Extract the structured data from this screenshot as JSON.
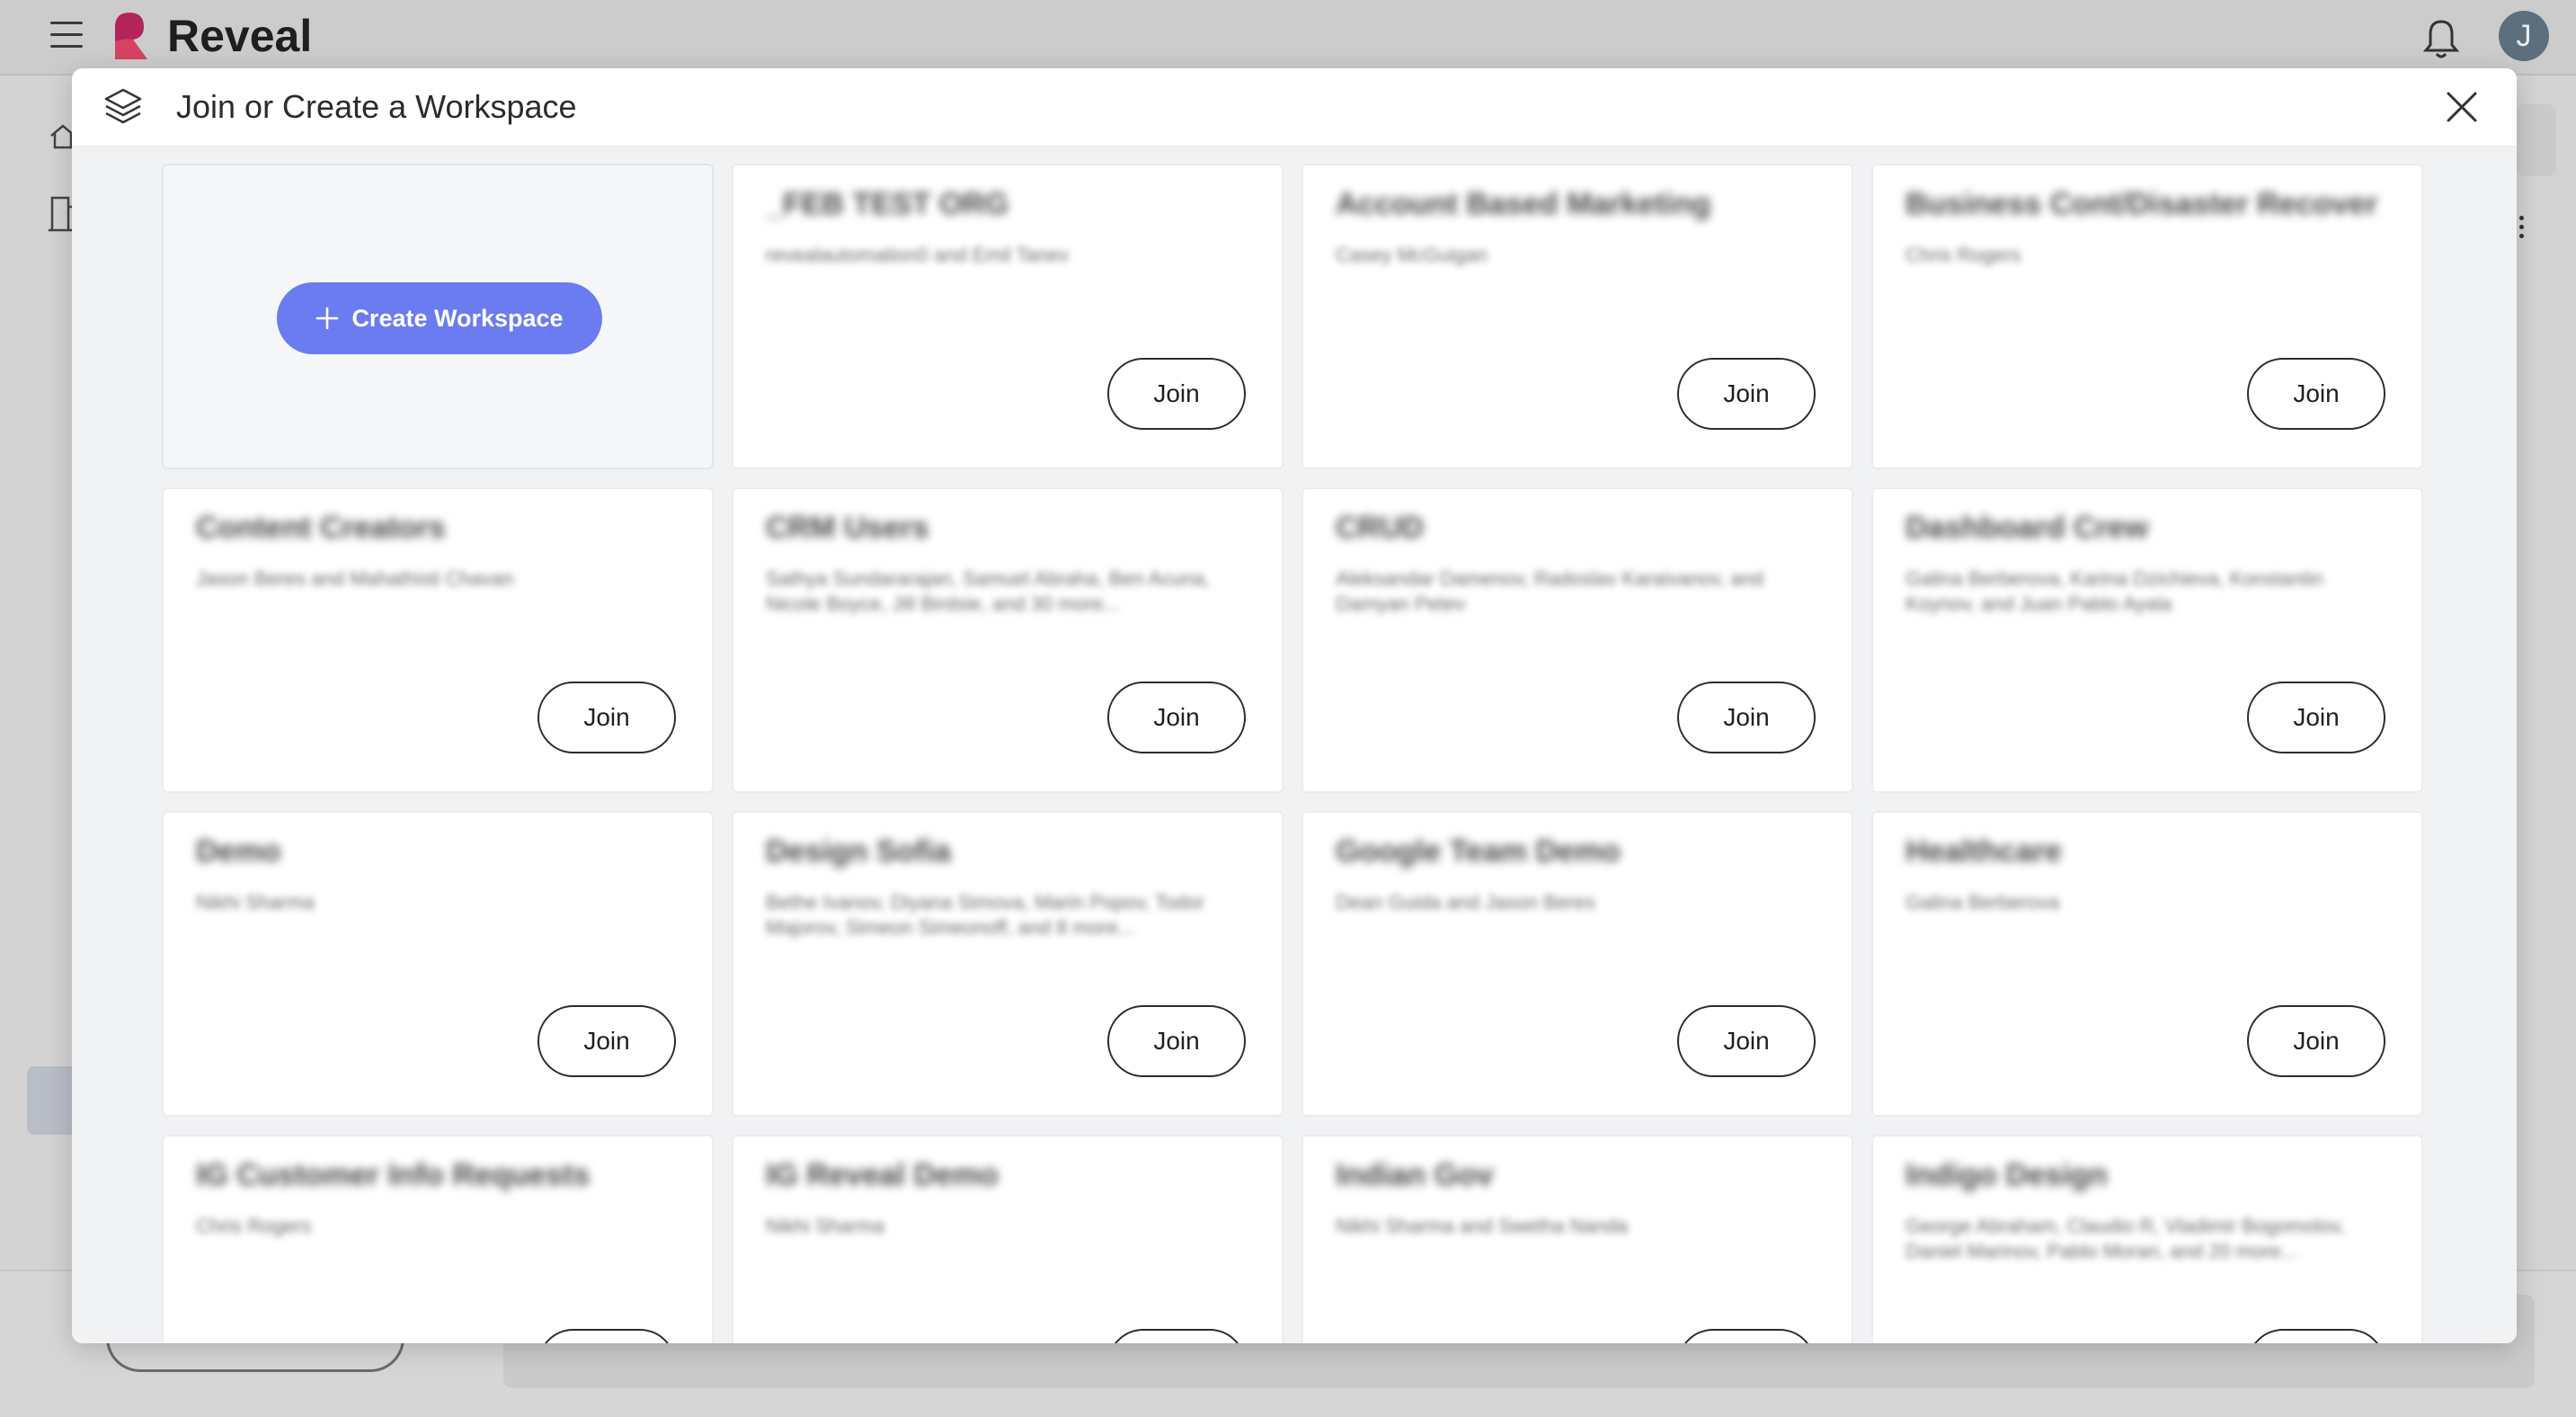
{
  "app": {
    "name": "Reveal",
    "user_initial": "J"
  },
  "modal": {
    "title": "Join or Create a Workspace",
    "create_label": "Create Workspace",
    "join_label": "Join",
    "workspaces": [
      {
        "name": "_FEB TEST ORG",
        "members": "revealautomation0 and Emil Tanev"
      },
      {
        "name": "Account Based Marketing",
        "members": "Casey McGuigan"
      },
      {
        "name": "Business Cont/Disaster Recover",
        "members": "Chris Rogers"
      },
      {
        "name": "Content Creators",
        "members": "Jason Beres and Mahathisti Chavan"
      },
      {
        "name": "CRM Users",
        "members": "Sathya Sundararajan, Samuel Abraha, Ben Acuna, Nicole Boyce, Jill Birdsie, and 30 more..."
      },
      {
        "name": "CRUD",
        "members": "Aleksandar Damenov, Radoslav Karaivanov, and Damyan Petev"
      },
      {
        "name": "Dashboard Crew",
        "members": "Galina Berberova, Karina Dzichieva, Konstantin Koynov, and Juan Pablo Ayala"
      },
      {
        "name": "Demo",
        "members": "Nikhi Sharma"
      },
      {
        "name": "Design Sofia",
        "members": "Bethe Ivanov, Diyana Simova, Marin Popov, Todor Majorov, Simeon Simeonoff, and 8 more..."
      },
      {
        "name": "Google Team Demo",
        "members": "Dean Guida and Jason Beres"
      },
      {
        "name": "Healthcare",
        "members": "Galina Berberova"
      },
      {
        "name": "IG Customer Info Requests",
        "members": "Chris Rogers"
      },
      {
        "name": "IG Reveal Demo",
        "members": "Nikhi Sharma"
      },
      {
        "name": "Indian Gov",
        "members": "Nikhi Sharma and Swetha Nanda"
      },
      {
        "name": "Indigo Design",
        "members": "George Abraham, Claudio R, Vladimir Bogomolov, Daniel Marinov, Pablo Moran, and 20 more..."
      }
    ]
  }
}
